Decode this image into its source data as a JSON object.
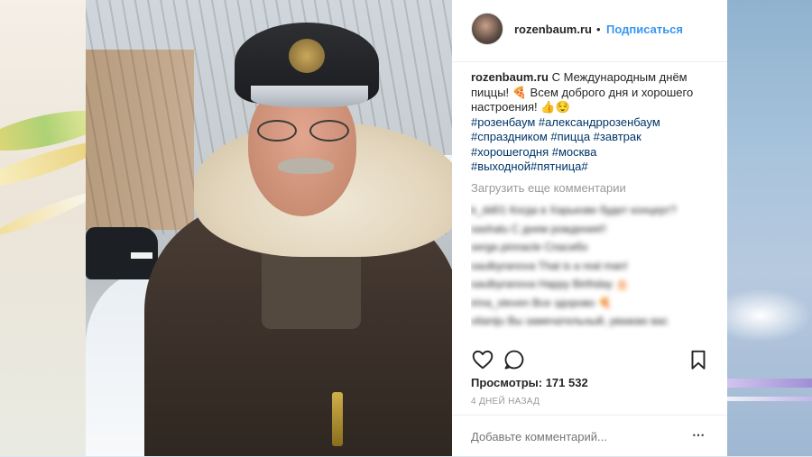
{
  "post": {
    "username": "rozenbaum.ru",
    "separator": "•",
    "follow_label": "Подписаться",
    "caption_user": "rozenbaum.ru",
    "caption_text": "С Международным днём пиццы! 🍕 Всем доброго дня и хорошего настроения! 👍😌",
    "hashtags": "#розенбаум #александррозенбаум #спраздником #пицца #завтрак #хорошегодня #москва #выходной#пятница#",
    "load_more": "Загрузить еще комментарии",
    "views": "Просмотры: 171 532",
    "date": "4 ДНЕЙ НАЗАД",
    "comment_placeholder": "Добавьте комментарий...",
    "more_icon": "⋯"
  },
  "comments": [
    "k_dd01 Когда в Харькове будет концерт?",
    "sashalu С днем рождения!!",
    "serge.pinnacle Спасибо",
    "saulbyranova That is a real man!",
    "saulbyranova Happy Birthday 🎂",
    "irina_steven Все здорово 🍕",
    "vitaniju Вы замечательный, уважаю вас"
  ],
  "icons": {
    "like": "heart-icon",
    "comment": "comment-icon",
    "save": "bookmark-icon",
    "more": "more-options-icon"
  },
  "colors": {
    "link_blue": "#3897f0",
    "hashtag": "#003569",
    "text": "#262626",
    "muted": "#999999"
  }
}
